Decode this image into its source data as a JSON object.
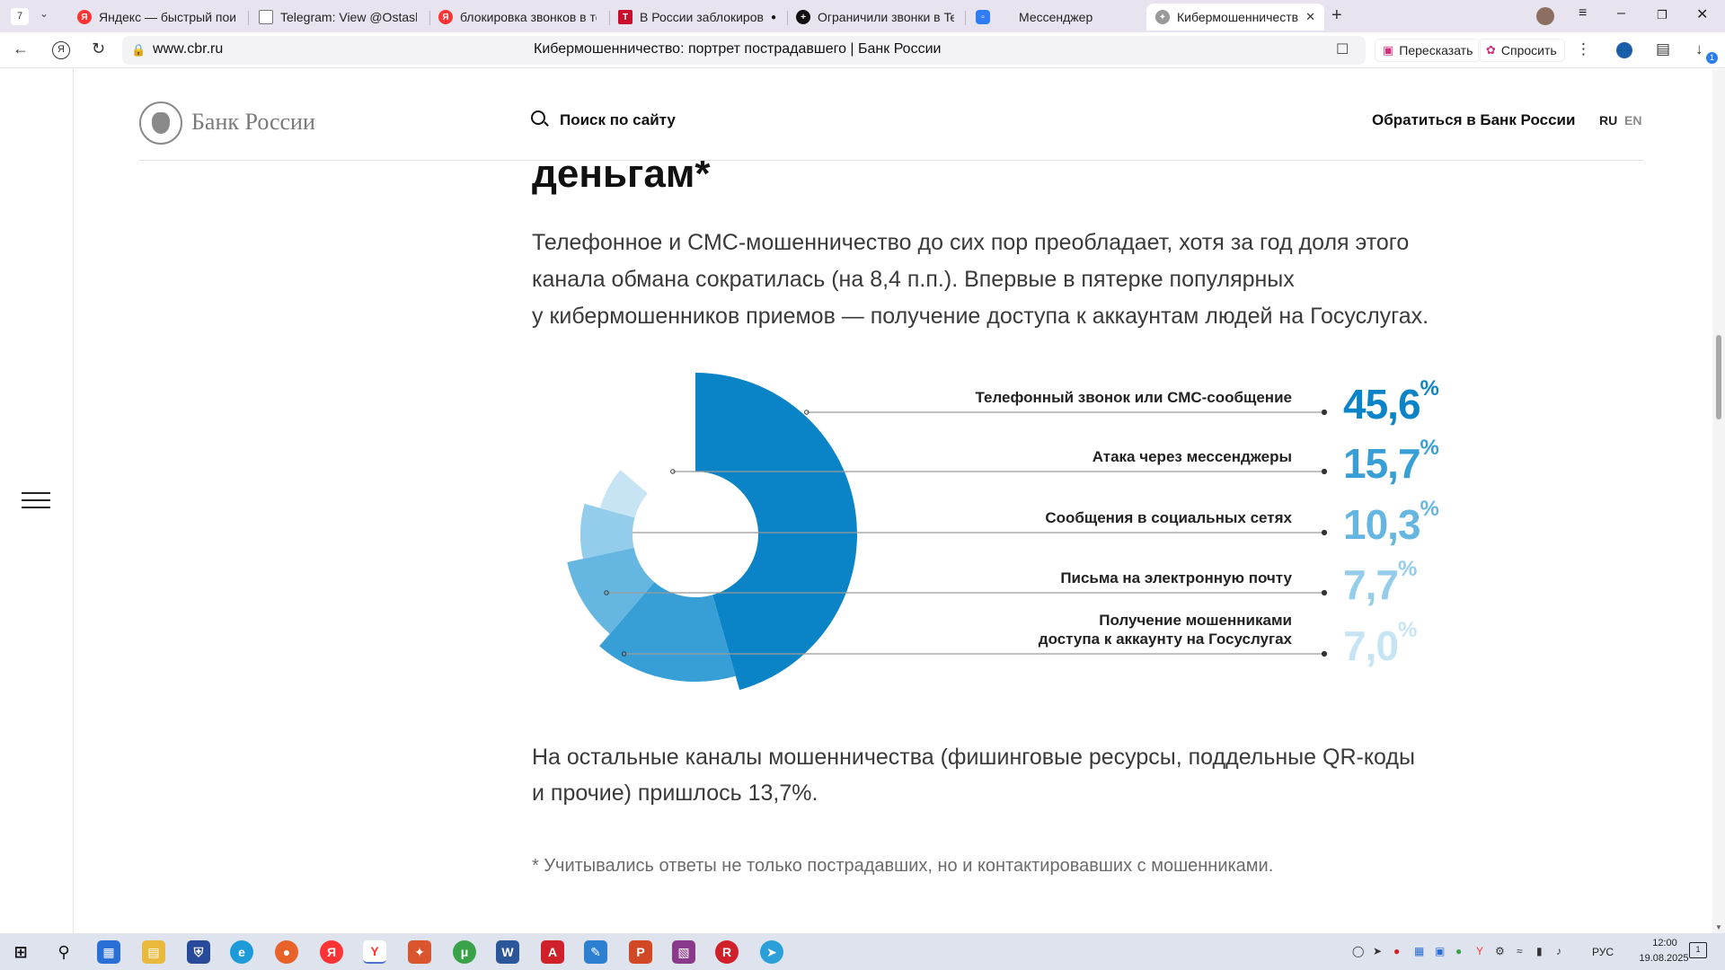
{
  "browser": {
    "tab_count": "7",
    "tabs": [
      {
        "label": "Яндекс — быстрый поиск",
        "icon": "yandex-icon",
        "color": "#f33"
      },
      {
        "label": "Telegram: View @Ostashk",
        "icon": "document-icon",
        "color": "#777"
      },
      {
        "label": "блокировка звонков в те",
        "icon": "yandex-icon",
        "color": "#f33"
      },
      {
        "label": "В России заблокирова",
        "icon": "t-journal-icon",
        "color": "#c8102e"
      },
      {
        "label": "Ограничили звонки в Tel",
        "icon": "plus-circle-icon",
        "color": "#111"
      },
      {
        "label": "Мессенджер",
        "icon": "messenger-icon",
        "color": "#2f7cf6"
      },
      {
        "label": "Кибермошенничество",
        "icon": "cbr-eagle-icon",
        "color": "#888"
      }
    ],
    "url": "www.cbr.ru",
    "page_title": "Кибермошенничество: портрет пострадавшего | Банк России",
    "retell_label": "Пересказать",
    "ask_label": "Спросить",
    "download_badge": "1"
  },
  "header": {
    "logo_text": "Банк России",
    "search_label": "Поиск по сайту",
    "contact_label": "Обратиться в Банк России",
    "lang_ru": "RU",
    "lang_en": "EN"
  },
  "article": {
    "heading_tail": "деньгам*",
    "lead_lines": [
      "Телефонное и СМС-мошенничество до сих пор преобладает, хотя за год доля этого",
      "канала обмана сократилась (на 8,4 п.п.). Впервые в пятерке популярных",
      "у кибермошенников приемов — получение доступа к аккаунтам людей на Госуслугах."
    ],
    "after_lines": [
      "На остальные каналы мошенничества (фишинговые ресурсы, поддельные QR-коды",
      "и прочие) пришлось 13,7%."
    ],
    "footnote": "* Учитывались ответы не только пострадавших, но и контактировавших с мошенниками."
  },
  "chart_data": {
    "type": "pie",
    "title": "",
    "unit": "%",
    "categories": [
      "Телефонный звонок или СМС-сообщение",
      "Атака через мессенджеры",
      "Сообщения в социальных сетях",
      "Письма на электронную почту",
      "Получение мошенниками доступа к аккаунту на Госуслугах"
    ],
    "label_lines": [
      [
        "Телефонный звонок или СМС-сообщение"
      ],
      [
        "Атака через мессенджеры"
      ],
      [
        "Сообщения в социальных сетях"
      ],
      [
        "Письма на электронную почту"
      ],
      [
        "Получение мошенниками",
        "доступа к аккаунту на Госуслугах"
      ]
    ],
    "values": [
      45.6,
      15.7,
      10.3,
      7.7,
      7.0
    ],
    "value_labels": [
      "45,6",
      "15,7",
      "10,3",
      "7,7",
      "7,0"
    ],
    "colors": [
      "#0a84c6",
      "#379fd6",
      "#65b7e2",
      "#94cdec",
      "#c7e4f4"
    ],
    "legend": "right"
  },
  "taskbar": {
    "lang": "РУС",
    "time": "12:00",
    "date": "19.08.2025",
    "notifications": "1"
  }
}
